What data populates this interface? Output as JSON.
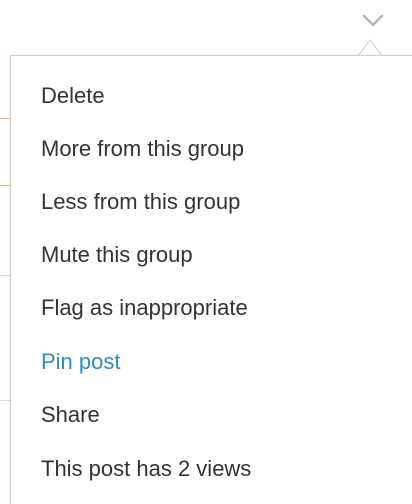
{
  "menu": {
    "items": [
      {
        "label": "Delete"
      },
      {
        "label": "More from this group"
      },
      {
        "label": "Less from this group"
      },
      {
        "label": "Mute this group"
      },
      {
        "label": "Flag as inappropriate"
      },
      {
        "label": "Pin post"
      },
      {
        "label": "Share"
      },
      {
        "label": "This post has 2 views"
      }
    ]
  },
  "icons": {
    "toggle": "chevron-down-icon"
  },
  "colors": {
    "text": "#333333",
    "accent": "#2e8bc9",
    "border": "#cfcfcf"
  }
}
